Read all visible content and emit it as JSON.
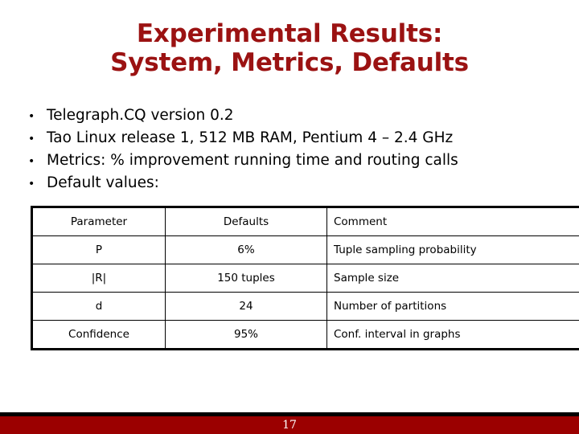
{
  "slide": {
    "title": {
      "line1": "Experimental Results:",
      "line2": "System, Metrics, Defaults",
      "color": "#9B1212"
    },
    "bullets": [
      {
        "marker": "•",
        "text": "Telegraph.CQ version 0.2"
      },
      {
        "marker": "•",
        "text": "Tao Linux release 1, 512 MB RAM, Pentium 4 – 2.4 GHz"
      },
      {
        "marker": "•",
        "text": "Metrics: % improvement running time and routing calls"
      },
      {
        "marker": "•",
        "text": "Default values:"
      }
    ],
    "table": {
      "headers": [
        "Parameter",
        "Defaults",
        "Comment"
      ],
      "rows": [
        {
          "parameter": "P",
          "default": "6%",
          "comment": "Tuple sampling probability"
        },
        {
          "parameter": "|R|",
          "default": "150 tuples",
          "comment": "Sample size"
        },
        {
          "parameter": "d",
          "default": "24",
          "comment": "Number of partitions"
        },
        {
          "parameter": "Confidence",
          "default": "95%",
          "comment": "Conf. interval in graphs"
        }
      ]
    },
    "footer": {
      "page_number": "17",
      "bar_color": "#9B0000",
      "rule_color": "#000000"
    }
  }
}
